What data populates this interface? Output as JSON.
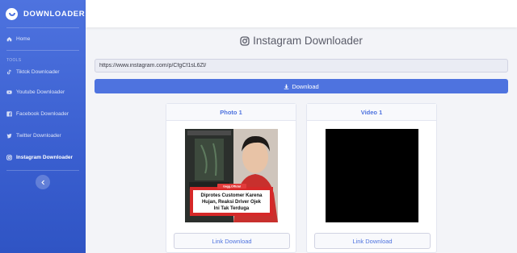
{
  "brand": {
    "name": "DOWNLOADER"
  },
  "sidebar": {
    "home": "Home",
    "section_heading": "TOOLS",
    "items": [
      {
        "label": "Tiktok Downloader",
        "icon": "tiktok-icon"
      },
      {
        "label": "Youtube Downloader",
        "icon": "youtube-icon"
      },
      {
        "label": "Facebook Downloader",
        "icon": "facebook-icon"
      },
      {
        "label": "Twitter Downloader",
        "icon": "twitter-icon"
      },
      {
        "label": "Instagram Downloader",
        "icon": "instagram-icon",
        "active": true
      }
    ],
    "toggle_icon": "chevron-left-icon"
  },
  "main": {
    "title": "Instagram Downloader",
    "url_value": "https://www.instagram.com/p/CfgCf1sL6Zl/",
    "download_label": "Download",
    "cards": [
      {
        "header": "Photo 1",
        "link_label": "Link Download",
        "caption": "Diprotes Customer Karena Hujan, Reaksi Driver Ojek Ini Tak Terduga"
      },
      {
        "header": "Video 1",
        "link_label": "Link Download"
      }
    ]
  },
  "colors": {
    "primary": "#4e73df",
    "sidebar_dark": "#2f54c4",
    "background": "#f3f4f8"
  }
}
